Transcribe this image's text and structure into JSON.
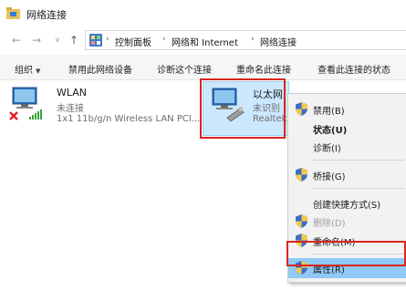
{
  "window": {
    "title": "网络连接"
  },
  "address": {
    "crumbs": [
      "控制面板",
      "网络和 Internet",
      "网络连接"
    ]
  },
  "toolbar": {
    "items": [
      "组织",
      "禁用此网络设备",
      "诊断这个连接",
      "重命名此连接",
      "查看此连接的状态"
    ]
  },
  "adapters": [
    {
      "name": "WLAN",
      "status": "未连接",
      "description": "1x1 11b/g/n Wireless LAN PCI..."
    },
    {
      "name": "以太网",
      "status": "未识别",
      "description": "Realtek"
    }
  ],
  "context_menu": {
    "items": [
      {
        "label": "禁用(B)",
        "icon": "shield-icon",
        "bold": false,
        "disabled": false
      },
      {
        "label": "状态(U)",
        "icon": "",
        "bold": true,
        "disabled": false
      },
      {
        "label": "诊断(I)",
        "icon": "",
        "bold": false,
        "disabled": false
      },
      {
        "label": "桥接(G)",
        "icon": "shield-icon",
        "bold": false,
        "disabled": false
      },
      {
        "label": "创建快捷方式(S)",
        "icon": "",
        "bold": false,
        "disabled": false
      },
      {
        "label": "删除(D)",
        "icon": "shield-icon",
        "bold": false,
        "disabled": true
      },
      {
        "label": "重命名(M)",
        "icon": "shield-icon",
        "bold": false,
        "disabled": false
      },
      {
        "label": "属性(R)",
        "icon": "shield-icon",
        "bold": false,
        "disabled": false,
        "highlighted": true
      }
    ]
  },
  "colors": {
    "highlight_border": "#d9261c",
    "selection": "#cce8ff",
    "menu_hover": "#91c9f7"
  }
}
